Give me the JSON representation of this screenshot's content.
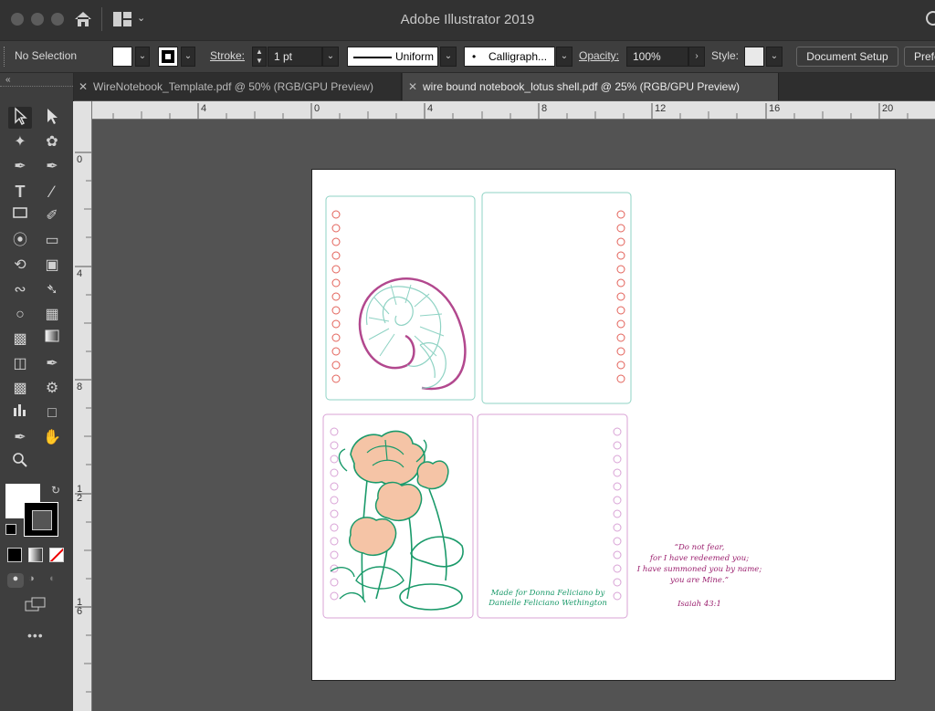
{
  "window": {
    "title": "Adobe Illustrator 2019"
  },
  "control_bar": {
    "selection": "No Selection",
    "stroke_label": "Stroke:",
    "stroke_weight": "1 pt",
    "profile": "Uniform",
    "brush": "Calligraph...",
    "opacity_label": "Opacity:",
    "opacity_value": "100%",
    "style_label": "Style:",
    "document_setup": "Document Setup",
    "preferences": "Prefe"
  },
  "tabs": [
    {
      "label": "WireNotebook_Template.pdf @ 50% (RGB/GPU Preview)",
      "active": false
    },
    {
      "label": "wire bound notebook_lotus shell.pdf @ 25% (RGB/GPU Preview)",
      "active": true
    }
  ],
  "rulers": {
    "top": [
      "4",
      "0",
      "4",
      "8",
      "12",
      "16",
      "20"
    ],
    "left": [
      "0",
      "4",
      "8",
      "1\n2",
      "1\n6"
    ]
  },
  "artwork": {
    "credit_line1": "Made for Donna Feliciano by",
    "credit_line2": "Danielle Feliciano Wethington",
    "quote_line1": "“Do not fear,",
    "quote_line2": "for I have redeemed you;",
    "quote_line3": "I have summoned you by name;",
    "quote_line4": "you are Mine.”",
    "quote_ref": "Isaiah 43:1"
  },
  "colors": {
    "teal_outline": "#8fd3c4",
    "pink_outline": "#d9a3d6",
    "red_holes": "#e3625a",
    "shell_purple": "#b2488e",
    "lotus_green": "#1a9a6a",
    "lotus_peach": "#f5c4a6",
    "quote_purple": "#9b1f6e"
  },
  "toolbar_more": "•••"
}
